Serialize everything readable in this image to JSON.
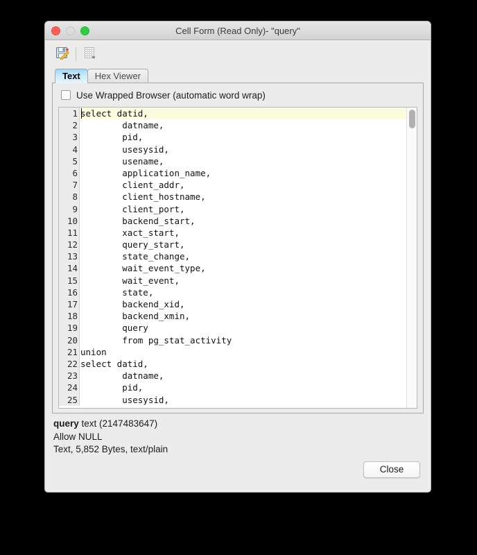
{
  "window": {
    "title": "Cell Form (Read Only)- \"query\"",
    "traffic_lights": [
      "close-button-red",
      "minimize-button-gray",
      "zoom-button-green"
    ]
  },
  "toolbar": {
    "buttons": [
      {
        "name": "save-edit-icon",
        "tooltip": "Save"
      },
      {
        "name": "grid-table-icon",
        "tooltip": "Table"
      }
    ]
  },
  "tabs": [
    {
      "label": "Text",
      "active": true
    },
    {
      "label": "Hex Viewer",
      "active": false
    }
  ],
  "options": {
    "wrapped_browser_label": "Use Wrapped Browser (automatic word wrap)",
    "wrapped_browser_checked": false
  },
  "editor": {
    "highlighted_line": 1,
    "cursor_line": 1,
    "cursor_column": 1,
    "scrollbar_position_pct": 1,
    "lines": [
      {
        "n": 1,
        "text": "select datid,"
      },
      {
        "n": 2,
        "text": "        datname,"
      },
      {
        "n": 3,
        "text": "        pid,"
      },
      {
        "n": 4,
        "text": "        usesysid,"
      },
      {
        "n": 5,
        "text": "        usename,"
      },
      {
        "n": 6,
        "text": "        application_name,"
      },
      {
        "n": 7,
        "text": "        client_addr,"
      },
      {
        "n": 8,
        "text": "        client_hostname,"
      },
      {
        "n": 9,
        "text": "        client_port,"
      },
      {
        "n": 10,
        "text": "        backend_start,"
      },
      {
        "n": 11,
        "text": "        xact_start,"
      },
      {
        "n": 12,
        "text": "        query_start,"
      },
      {
        "n": 13,
        "text": "        state_change,"
      },
      {
        "n": 14,
        "text": "        wait_event_type,"
      },
      {
        "n": 15,
        "text": "        wait_event,"
      },
      {
        "n": 16,
        "text": "        state,"
      },
      {
        "n": 17,
        "text": "        backend_xid,"
      },
      {
        "n": 18,
        "text": "        backend_xmin,"
      },
      {
        "n": 19,
        "text": "        query"
      },
      {
        "n": 20,
        "text": "        from pg_stat_activity"
      },
      {
        "n": 21,
        "text": "union"
      },
      {
        "n": 22,
        "text": "select datid,"
      },
      {
        "n": 23,
        "text": "        datname,"
      },
      {
        "n": 24,
        "text": "        pid,"
      },
      {
        "n": 25,
        "text": "        usesysid,"
      }
    ]
  },
  "info": {
    "column_name": "query",
    "type": "text (2147483647)",
    "nullability": "Allow NULL",
    "size_line": "Text, 5,852 Bytes, text/plain"
  },
  "footer": {
    "close_label": "Close"
  },
  "colors": {
    "window_bg": "#ececec",
    "active_tab": "#9fd8f7",
    "highlight_line": "#fbfbdd",
    "traffic_red": "#fb6058",
    "traffic_gray": "#dcdcdc",
    "traffic_green": "#2fcd41"
  }
}
